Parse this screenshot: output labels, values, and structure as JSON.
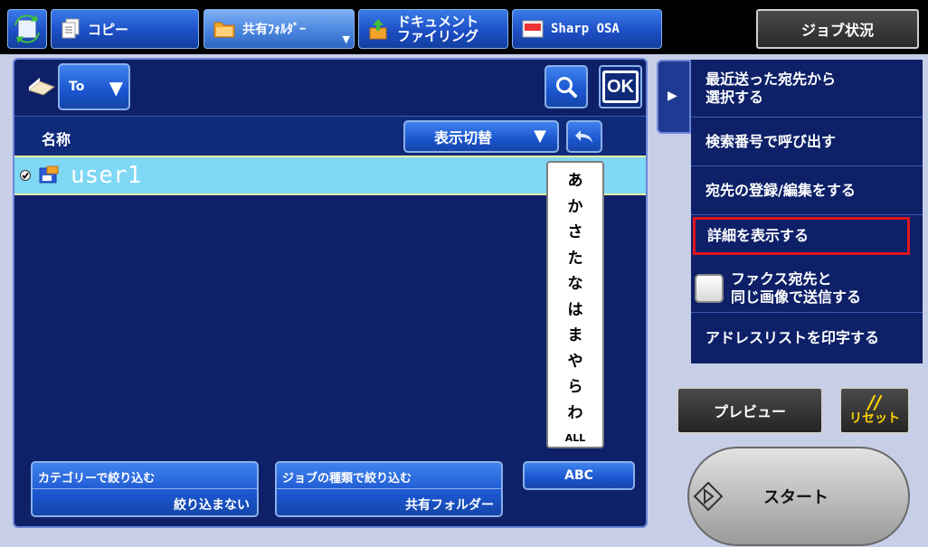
{
  "tabs": [
    {
      "label": "コピー"
    },
    {
      "label": "共有ﾌｫﾙﾀﾞｰ"
    },
    {
      "label_line1": "ドキュメント",
      "label_line2": "ファイリング"
    },
    {
      "label": "Sharp OSA"
    }
  ],
  "job_status_label": "ジョブ状況",
  "address": {
    "to_label": "To",
    "ok_label": "OK",
    "name_header": "名称",
    "view_switch_label": "表示切替",
    "entries": [
      {
        "name": "user1"
      }
    ],
    "kana_index": [
      "あ",
      "か",
      "さ",
      "た",
      "な",
      "は",
      "ま",
      "や",
      "ら",
      "わ",
      "ALL"
    ],
    "category_filter": {
      "title": "カテゴリーで絞り込む",
      "value": "絞り込まない"
    },
    "job_type_filter": {
      "title": "ジョブの種類で絞り込む",
      "value": "共有フォルダー"
    },
    "abc_label": "ABC"
  },
  "menu": {
    "recent": {
      "line1": "最近送った宛先から",
      "line2": "選択する"
    },
    "search_number": "検索番号で呼び出す",
    "register_edit": "宛先の登録/編集をする",
    "show_detail": "詳細を表示する",
    "fax_same_image": {
      "line1": "ファクス宛先と",
      "line2": "同じ画像で送信する"
    },
    "print_address_list": "アドレスリストを印字する"
  },
  "preview_label": "プレビュー",
  "reset_label": "リセット",
  "start_label": "スタート"
}
